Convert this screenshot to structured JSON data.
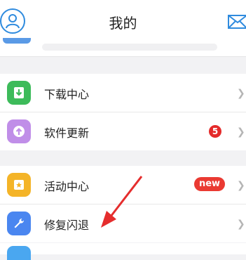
{
  "header": {
    "title": "我的",
    "avatar_icon": "user-icon",
    "mail_icon": "mail-icon"
  },
  "groups": [
    {
      "items": [
        {
          "label": "下载中心",
          "icon": "download-icon",
          "icon_color": "#3dbb5a"
        },
        {
          "label": "软件更新",
          "icon": "update-icon",
          "icon_color": "#c08ee8",
          "badge": "5"
        }
      ]
    },
    {
      "items": [
        {
          "label": "活动中心",
          "icon": "gift-star-icon",
          "icon_color": "#f4b428",
          "badge": "new"
        },
        {
          "label": "修复闪退",
          "icon": "wrench-icon",
          "icon_color": "#4a86f0"
        }
      ]
    }
  ],
  "colors": {
    "accent": "#2f8bde",
    "badge_red": "#e42a2a",
    "annotation_arrow": "#e52d2d"
  }
}
